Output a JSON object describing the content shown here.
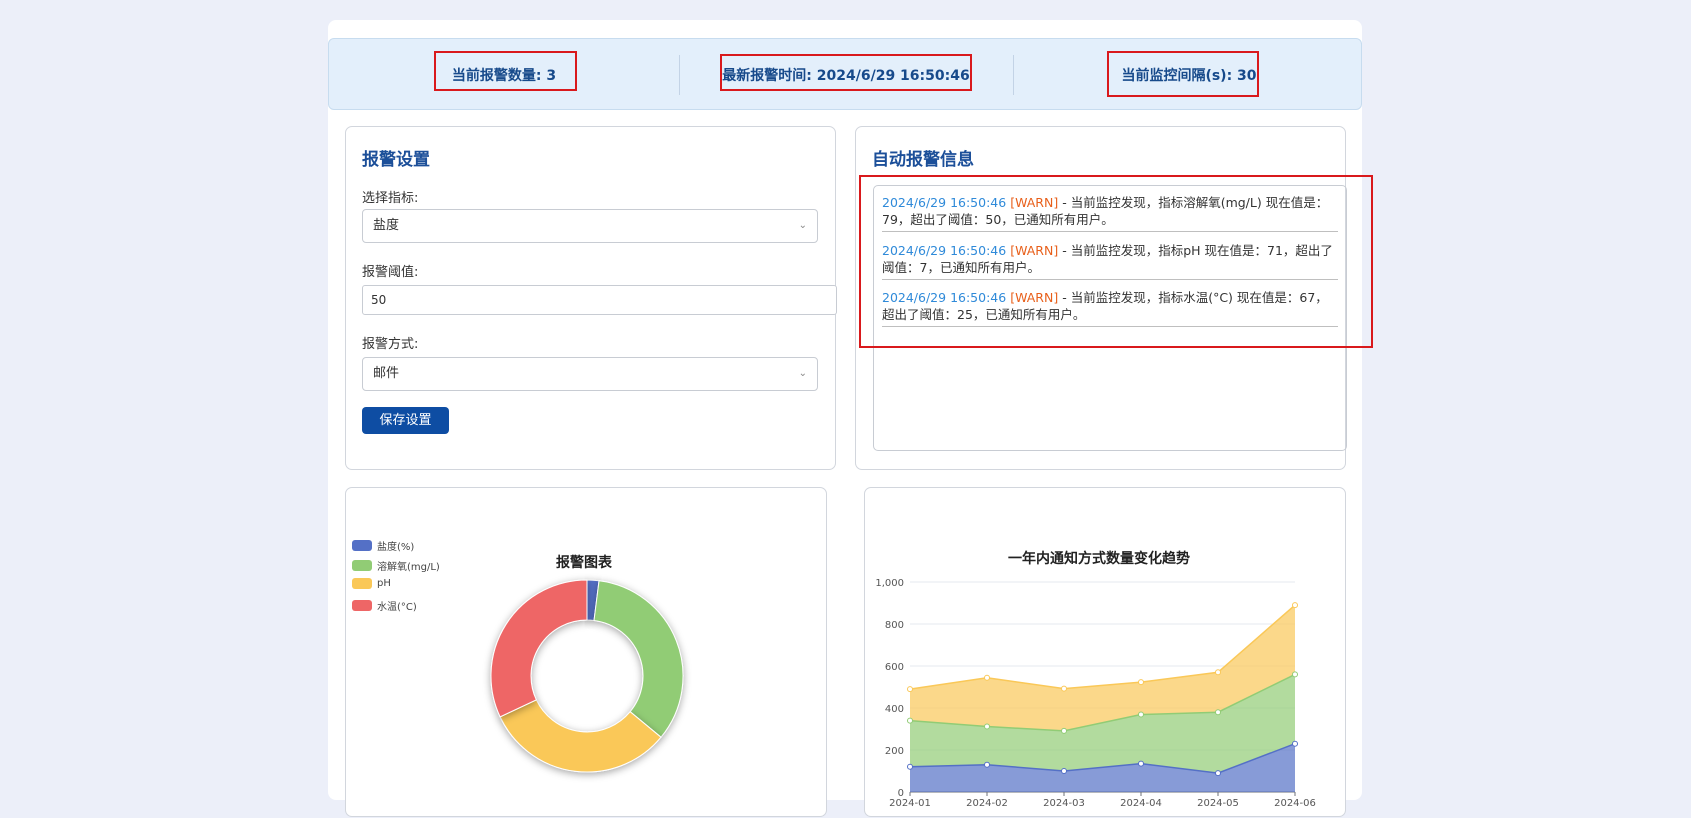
{
  "stats": {
    "alarm_count": "当前报警数量: 3",
    "latest_time": "最新报警时间: 2024/6/29 16:50:46",
    "interval": "当前监控间隔(s): 30"
  },
  "settings": {
    "title": "报警设置",
    "indicator_label": "选择指标:",
    "indicator_value": "盐度",
    "threshold_label": "报警阈值:",
    "threshold_value": "50",
    "method_label": "报警方式:",
    "method_value": "邮件",
    "save_label": "保存设置"
  },
  "alerts": {
    "title": "自动报警信息",
    "entries": [
      {
        "time": "2024/6/29 16:50:46",
        "level": "[WARN]",
        "message": " - 当前监控发现，指标溶解氧(mg/L) 现在值是：79，超出了阈值：50，已通知所有用户。"
      },
      {
        "time": "2024/6/29 16:50:46",
        "level": "[WARN]",
        "message": " - 当前监控发现，指标pH 现在值是：71，超出了阈值：7，已通知所有用户。"
      },
      {
        "time": "2024/6/29 16:50:46",
        "level": "[WARN]",
        "message": " - 当前监控发现，指标水温(°C) 现在值是：67，超出了阈值：25，已通知所有用户。"
      }
    ]
  },
  "colors": {
    "blue": "#5470c6",
    "green": "#91cc75",
    "yellow": "#fac858",
    "red": "#ee6666"
  },
  "chart_data": [
    {
      "type": "pie",
      "title": "报警图表",
      "legend_position": "top-left",
      "series": [
        {
          "name": "盐度(%)",
          "value": 2
        },
        {
          "name": "溶解氧(mg/L)",
          "value": 34
        },
        {
          "name": "pH",
          "value": 32
        },
        {
          "name": "水温(°C)",
          "value": 32
        }
      ]
    },
    {
      "type": "area",
      "title": "一年内通知方式数量变化趋势",
      "categories": [
        "2024-01",
        "2024-02",
        "2024-03",
        "2024-04",
        "2024-05",
        "2024-06"
      ],
      "ylim": [
        0,
        1000
      ],
      "yticks": [
        "0",
        "200",
        "400",
        "600",
        "800",
        "1,000"
      ],
      "stacked": true,
      "grid": true,
      "series": [
        {
          "values": [
            120,
            130,
            100,
            135,
            90,
            230
          ]
        },
        {
          "values": [
            220,
            182,
            191,
            234,
            290,
            330
          ]
        },
        {
          "values": [
            150,
            232,
            201,
            154,
            190,
            330
          ]
        }
      ]
    }
  ]
}
